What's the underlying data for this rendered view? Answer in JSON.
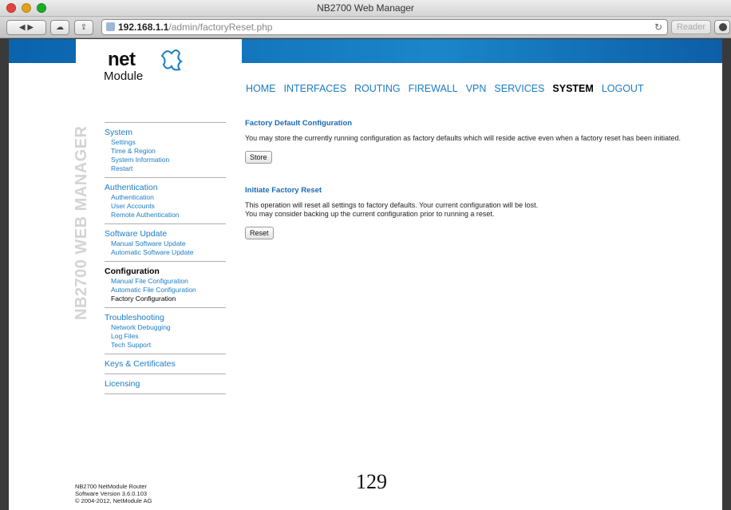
{
  "window": {
    "title": "NB2700 Web Manager"
  },
  "toolbar": {
    "url_host": "192.168.1.1",
    "url_path": "/admin/factoryReset.php",
    "reader_label": "Reader",
    "reload_glyph": "↻"
  },
  "brand": {
    "net": "net",
    "module": "Module",
    "side_title": "NB2700 WEB MANAGER"
  },
  "nav": [
    "HOME",
    "INTERFACES",
    "ROUTING",
    "FIREWALL",
    "VPN",
    "SERVICES",
    "SYSTEM",
    "LOGOUT"
  ],
  "nav_active": "SYSTEM",
  "sidebar": [
    {
      "title": "System",
      "items": [
        "Settings",
        "Time & Region",
        "System Information",
        "Restart"
      ]
    },
    {
      "title": "Authentication",
      "items": [
        "Authentication",
        "User Accounts",
        "Remote Authentication"
      ]
    },
    {
      "title": "Software Update",
      "items": [
        "Manual Software Update",
        "Automatic Software Update"
      ]
    },
    {
      "title": "Configuration",
      "items": [
        "Manual File Configuration",
        "Automatic File Configuration",
        "Factory Configuration"
      ],
      "bold": true,
      "current": "Factory Configuration"
    },
    {
      "title": "Troubleshooting",
      "items": [
        "Network Debugging",
        "Log Files",
        "Tech Support"
      ]
    },
    {
      "title": "Keys & Certificates",
      "items": []
    },
    {
      "title": "Licensing",
      "items": []
    }
  ],
  "main": {
    "default_heading": "Factory Default Configuration",
    "default_text": "You may store the currently running configuration as factory defaults which will reside active even when a factory reset has been initiated.",
    "store_label": "Store",
    "reset_heading": "Initiate Factory Reset",
    "reset_text_1": "This operation will reset all settings to factory defaults. Your current configuration will be lost.",
    "reset_text_2": "You may consider backing up the current configuration prior to running a reset.",
    "reset_label": "Reset"
  },
  "footer": {
    "line1": "NB2700 NetModule Router",
    "line2": "Software Version 3.6.0.103",
    "line3": "© 2004-2012, NetModule AG"
  },
  "page_number": "129",
  "colors": {
    "link": "#1a7cc4",
    "heading": "#1a6ab5",
    "banner": "#1a86c9"
  }
}
